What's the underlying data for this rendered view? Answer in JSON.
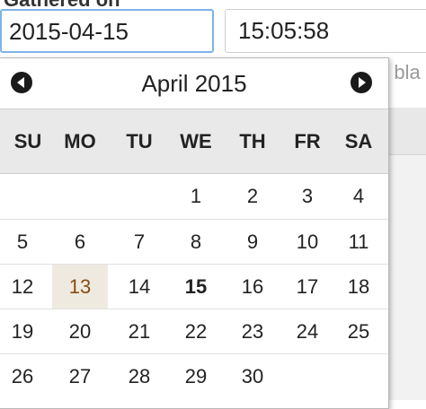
{
  "field": {
    "label": "Gathered on",
    "date_value": "2015-04-15",
    "time_value": "15:05:58"
  },
  "background": {
    "hint_text": "e bla"
  },
  "calendar": {
    "month_title": "April 2015",
    "prev_icon": "chevron-left-circle-icon",
    "next_icon": "chevron-right-circle-icon",
    "weekdays": [
      "SU",
      "MO",
      "TU",
      "WE",
      "TH",
      "FR",
      "SA"
    ],
    "weeks": [
      [
        "",
        "",
        "",
        "1",
        "2",
        "3",
        "4"
      ],
      [
        "5",
        "6",
        "7",
        "8",
        "9",
        "10",
        "11"
      ],
      [
        "12",
        "13",
        "14",
        "15",
        "16",
        "17",
        "18"
      ],
      [
        "19",
        "20",
        "21",
        "22",
        "23",
        "24",
        "25"
      ],
      [
        "26",
        "27",
        "28",
        "29",
        "30",
        "",
        ""
      ]
    ],
    "today": "13",
    "selected": "15",
    "colors": {
      "today_bg": "#eeeae0",
      "today_text": "#8a4b0f",
      "weekday_bg": "#e9e9e9",
      "focus_border": "#7db3ea"
    }
  }
}
